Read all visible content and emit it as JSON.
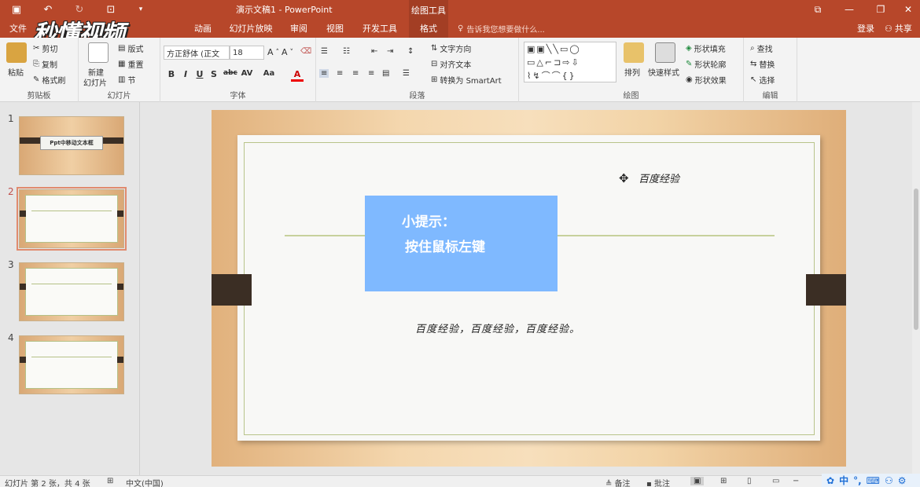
{
  "titlebar": {
    "title": "演示文稿1 - PowerPoint",
    "context_tab": "绘图工具"
  },
  "logo": {
    "text": "秒懂视频"
  },
  "tabs": {
    "file": "文件",
    "animation": "动画",
    "slideshow": "幻灯片放映",
    "review": "审阅",
    "view": "视图",
    "developer": "开发工具",
    "format": "格式",
    "tell_me": "告诉我您想要做什么...",
    "login": "登录",
    "share": "共享"
  },
  "ribbon": {
    "clipboard": {
      "paste": "粘贴",
      "cut": "剪切",
      "copy": "复制",
      "painter": "格式刷",
      "label": "剪贴板"
    },
    "slides": {
      "new": "新建",
      "new2": "幻灯片",
      "layout": "版式",
      "reset": "重置",
      "section": "节",
      "label": "幻灯片"
    },
    "font": {
      "name": "方正舒体 (正文",
      "size": "18",
      "label": "字体"
    },
    "paragraph": {
      "direction": "文字方向",
      "align": "对齐文本",
      "smartart": "转换为 SmartArt",
      "label": "段落"
    },
    "drawing": {
      "arrange": "排列",
      "quickstyle": "快速样式",
      "fill": "形状填充",
      "outline": "形状轮廓",
      "effect": "形状效果",
      "label": "绘图"
    },
    "editing": {
      "find": "查找",
      "replace": "替换",
      "select": "选择",
      "label": "编辑"
    }
  },
  "thumbs": {
    "n1": "1",
    "n2": "2",
    "n3": "3",
    "n4": "4",
    "t1_title": "Ppt中移动文本框"
  },
  "slide": {
    "tip_title": "小提示：",
    "tip_body": "按住鼠标左键",
    "signature": "百度经验",
    "body": "百度经验，百度经验，百度经验。"
  },
  "status": {
    "slide_info": "幻灯片 第 2 张，共 4 张",
    "language": "中文(中国)",
    "notes": "备注",
    "comments": "批注"
  },
  "ime": {
    "lang": "中"
  },
  "colors": {
    "accent": "#b7472a",
    "tip_box": "#7fb9ff"
  }
}
